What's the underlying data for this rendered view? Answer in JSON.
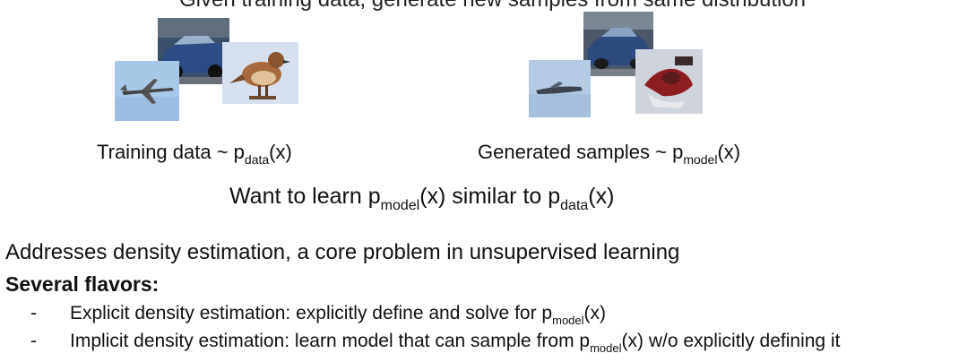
{
  "top_line": {
    "prefix": "Given training data, generate new samples from same distribution",
    "note": "partially visible"
  },
  "training_caption": {
    "text": "Training data ~ p",
    "sub": "data",
    "tail": "(x)"
  },
  "generated_caption": {
    "text": "Generated samples ~ p",
    "sub": "model",
    "tail": "(x)"
  },
  "goal": {
    "text1": "Want to learn p",
    "sub1": "model",
    "mid": "(x) similar to p",
    "sub2": "data",
    "tail": "(x)"
  },
  "addresses": "Addresses density estimation, a core problem in unsupervised learning",
  "flavors_heading": "Several flavors:",
  "bullets": [
    {
      "dash": "-",
      "text": "Explicit density estimation: explicitly define and solve for p",
      "sub": "model",
      "tail": "(x)"
    },
    {
      "dash": "-",
      "text": "Implicit density estimation: learn model that can sample from p",
      "sub": "model",
      "tail": "(x) w/o explicitly defining it"
    }
  ],
  "images": {
    "training": [
      "car-photo",
      "airplane-photo",
      "bird-photo"
    ],
    "generated": [
      "car-sample",
      "airplane-sample",
      "bird-sample"
    ]
  }
}
